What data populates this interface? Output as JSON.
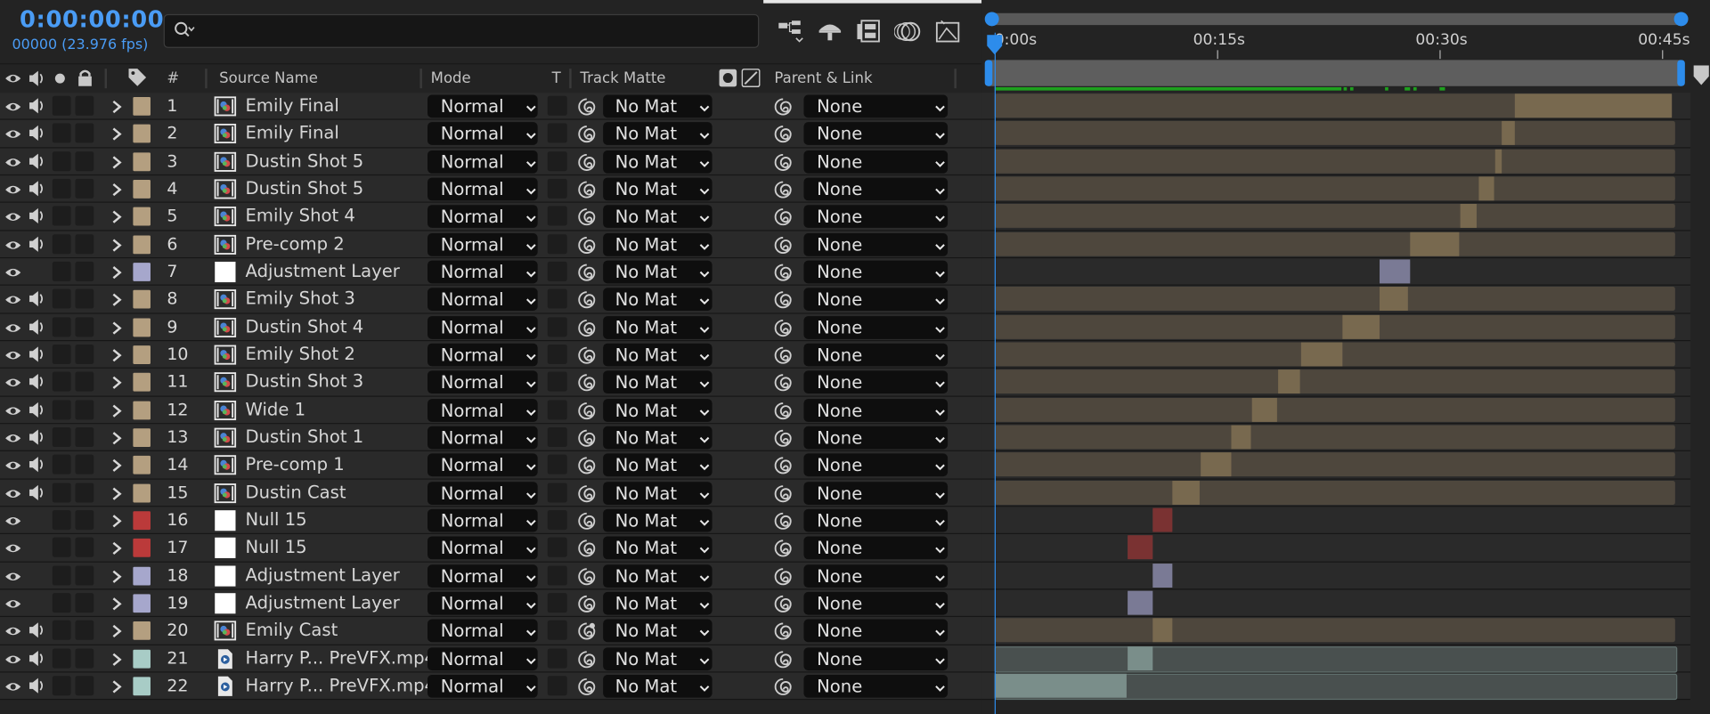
{
  "header_info": {
    "timecode": "0:00:00:00",
    "frames": "00000 (23.976 fps)"
  },
  "search": {
    "placeholder": ""
  },
  "columns": {
    "num": "#",
    "source_name": "Source Name",
    "mode": "Mode",
    "t": "T",
    "track_matte": "Track Matte",
    "parent_link": "Parent & Link"
  },
  "ruler": {
    "t0": "0:00s",
    "t15": "00:15s",
    "t30": "00:30s",
    "t45": "00:45s"
  },
  "colors": {
    "accent": "#2d8ceb",
    "footage": "#b49f80",
    "adjust": "#a6a7cc",
    "null": "#bb3a3a",
    "mp4": "#a8ccc6"
  },
  "layers": [
    {
      "num": "1",
      "name": "Emily Final",
      "type": "comp",
      "label": "#b49f80",
      "audio": true,
      "mode": "Normal",
      "matte": "No Mat",
      "parent": "None",
      "bar": {
        "kind": "footage",
        "start": 0,
        "end": 0.995,
        "hi_start": 0.765,
        "hi_end": 0.995
      }
    },
    {
      "num": "2",
      "name": "Emily Final",
      "type": "comp",
      "label": "#b49f80",
      "audio": true,
      "mode": "Normal",
      "matte": "No Mat",
      "parent": "None",
      "bar": {
        "kind": "footage",
        "start": 0,
        "end": 1,
        "hi_start": 0.745,
        "hi_end": 0.764
      }
    },
    {
      "num": "3",
      "name": "Dustin Shot 5",
      "type": "comp",
      "label": "#b49f80",
      "audio": true,
      "mode": "Normal",
      "matte": "No Mat",
      "parent": "None",
      "bar": {
        "kind": "footage",
        "start": 0,
        "end": 1,
        "hi_start": 0.735,
        "hi_end": 0.745
      }
    },
    {
      "num": "4",
      "name": "Dustin Shot 5",
      "type": "comp",
      "label": "#b49f80",
      "audio": true,
      "mode": "Normal",
      "matte": "No Mat",
      "parent": "None",
      "bar": {
        "kind": "footage",
        "start": 0,
        "end": 1,
        "hi_start": 0.711,
        "hi_end": 0.734
      }
    },
    {
      "num": "5",
      "name": "Emily Shot 4",
      "type": "comp",
      "label": "#b49f80",
      "audio": true,
      "mode": "Normal",
      "matte": "No Mat",
      "parent": "None",
      "bar": {
        "kind": "footage",
        "start": 0,
        "end": 1,
        "hi_start": 0.684,
        "hi_end": 0.708
      }
    },
    {
      "num": "6",
      "name": "Pre-comp 2",
      "type": "comp",
      "label": "#b49f80",
      "audio": true,
      "mode": "Normal",
      "matte": "No Mat",
      "parent": "None",
      "bar": {
        "kind": "footage",
        "start": 0,
        "end": 1,
        "hi_start": 0.61,
        "hi_end": 0.683
      }
    },
    {
      "num": "7",
      "name": "Adjustment Layer",
      "type": "solid",
      "label": "#a6a7cc",
      "audio": false,
      "mode": "Normal",
      "matte": "No Mat",
      "parent": "None",
      "bar": {
        "kind": "adjust",
        "start": 0.565,
        "end": 0.61,
        "hi_start": 0.565,
        "hi_end": 0.61
      }
    },
    {
      "num": "8",
      "name": "Emily Shot 3",
      "type": "comp",
      "label": "#b49f80",
      "audio": true,
      "mode": "Normal",
      "matte": "No Mat",
      "parent": "None",
      "bar": {
        "kind": "footage",
        "start": 0,
        "end": 1,
        "hi_start": 0.566,
        "hi_end": 0.608
      }
    },
    {
      "num": "9",
      "name": "Dustin Shot 4",
      "type": "comp",
      "label": "#b49f80",
      "audio": true,
      "mode": "Normal",
      "matte": "No Mat",
      "parent": "None",
      "bar": {
        "kind": "footage",
        "start": 0,
        "end": 1,
        "hi_start": 0.512,
        "hi_end": 0.565
      }
    },
    {
      "num": "10",
      "name": "Emily Shot 2",
      "type": "comp",
      "label": "#b49f80",
      "audio": true,
      "mode": "Normal",
      "matte": "No Mat",
      "parent": "None",
      "bar": {
        "kind": "footage",
        "start": 0,
        "end": 1,
        "hi_start": 0.45,
        "hi_end": 0.511
      }
    },
    {
      "num": "11",
      "name": "Dustin Shot 3",
      "type": "comp",
      "label": "#b49f80",
      "audio": true,
      "mode": "Normal",
      "matte": "No Mat",
      "parent": "None",
      "bar": {
        "kind": "footage",
        "start": 0,
        "end": 1,
        "hi_start": 0.416,
        "hi_end": 0.449
      }
    },
    {
      "num": "12",
      "name": "Wide 1",
      "type": "comp",
      "label": "#b49f80",
      "audio": true,
      "mode": "Normal",
      "matte": "No Mat",
      "parent": "None",
      "bar": {
        "kind": "footage",
        "start": 0,
        "end": 1,
        "hi_start": 0.378,
        "hi_end": 0.415
      }
    },
    {
      "num": "13",
      "name": "Dustin Shot 1",
      "type": "comp",
      "label": "#b49f80",
      "audio": true,
      "mode": "Normal",
      "matte": "No Mat",
      "parent": "None",
      "bar": {
        "kind": "footage",
        "start": 0,
        "end": 1,
        "hi_start": 0.348,
        "hi_end": 0.377
      }
    },
    {
      "num": "14",
      "name": "Pre-comp 1",
      "type": "comp",
      "label": "#b49f80",
      "audio": true,
      "mode": "Normal",
      "matte": "No Mat",
      "parent": "None",
      "bar": {
        "kind": "footage",
        "start": 0,
        "end": 1,
        "hi_start": 0.303,
        "hi_end": 0.347
      }
    },
    {
      "num": "15",
      "name": "Dustin Cast",
      "type": "comp",
      "label": "#b49f80",
      "audio": true,
      "mode": "Normal",
      "matte": "No Mat",
      "parent": "None",
      "bar": {
        "kind": "footage",
        "start": 0,
        "end": 1,
        "hi_start": 0.262,
        "hi_end": 0.302
      }
    },
    {
      "num": "16",
      "name": "Null 15",
      "type": "solid",
      "label": "#bb3a3a",
      "audio": false,
      "mode": "Normal",
      "matte": "No Mat",
      "parent": "None",
      "bar": {
        "kind": "null",
        "start": 0.233,
        "end": 0.262,
        "hi_start": 0.233,
        "hi_end": 0.262
      }
    },
    {
      "num": "17",
      "name": "Null 15",
      "type": "solid",
      "label": "#bb3a3a",
      "audio": false,
      "mode": "Normal",
      "matte": "No Mat",
      "parent": "None",
      "bar": {
        "kind": "null",
        "start": 0.195,
        "end": 0.232,
        "hi_start": 0.195,
        "hi_end": 0.232
      }
    },
    {
      "num": "18",
      "name": "Adjustment Layer",
      "type": "solid",
      "label": "#a6a7cc",
      "audio": false,
      "mode": "Normal",
      "matte": "No Mat",
      "parent": "None",
      "bar": {
        "kind": "adjust",
        "start": 0.233,
        "end": 0.262,
        "hi_start": 0.233,
        "hi_end": 0.262
      }
    },
    {
      "num": "19",
      "name": "Adjustment Layer",
      "type": "solid",
      "label": "#a6a7cc",
      "audio": false,
      "mode": "Normal",
      "matte": "No Mat",
      "parent": "None",
      "bar": {
        "kind": "adjust",
        "start": 0.195,
        "end": 0.232,
        "hi_start": 0.195,
        "hi_end": 0.232
      }
    },
    {
      "num": "20",
      "name": "Emily Cast",
      "type": "comp",
      "label": "#b49f80",
      "audio": true,
      "mode": "Normal",
      "matte": "No Mat",
      "parent": "None",
      "bar": {
        "kind": "footage",
        "start": 0,
        "end": 1,
        "hi_start": 0.233,
        "hi_end": 0.261
      }
    },
    {
      "num": "21",
      "name": "Harry P... PreVFX.mp4",
      "type": "mp4",
      "label": "#a8ccc6",
      "audio": true,
      "mode": "Normal",
      "matte": "No Mat",
      "parent": "None",
      "bar": {
        "kind": "mp4",
        "start": 0,
        "end": 1,
        "hi_start": 0.195,
        "hi_end": 0.232
      }
    },
    {
      "num": "22",
      "name": "Harry P... PreVFX.mp4",
      "type": "mp4",
      "label": "#a8ccc6",
      "audio": true,
      "mode": "Normal",
      "matte": "No Mat",
      "parent": "None",
      "bar": {
        "kind": "mp4",
        "start": 0,
        "end": 1,
        "hi_start": 0,
        "hi_end": 0.194
      }
    }
  ]
}
